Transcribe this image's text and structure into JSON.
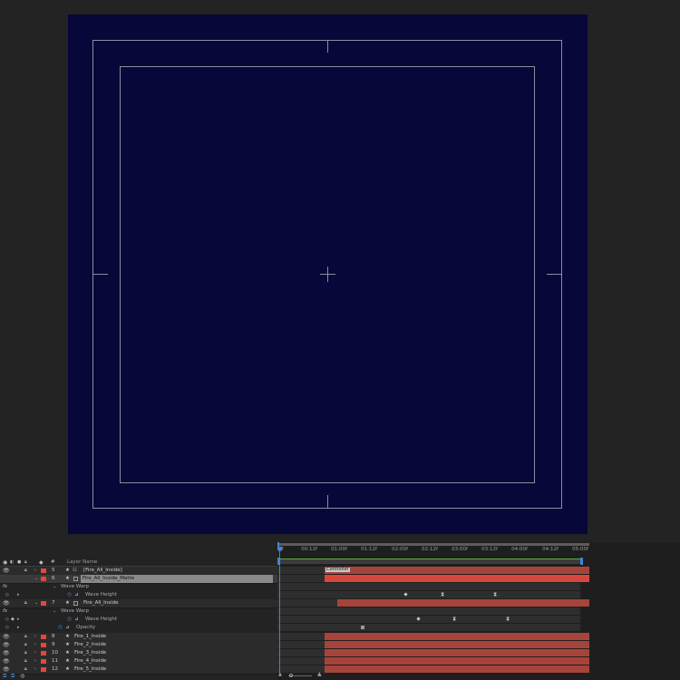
{
  "colors": {
    "comp_background": "#07073a",
    "label_red": "#e0483e",
    "playhead_blue": "#3d87d6",
    "work_area_green": "#5fae3c"
  },
  "layer_header": {
    "hash": "#",
    "layer_name": "Layer Name"
  },
  "layers": [
    {
      "num": "5",
      "name": "[Fire_All_Inside]"
    },
    {
      "num": "6",
      "name": "Fire_All_Inside_Matte"
    },
    {
      "num": "7",
      "name": "Fire_All_Inside"
    },
    {
      "num": "8",
      "name": "Fire_1_Inside"
    },
    {
      "num": "9",
      "name": "Fire_2_Inside"
    },
    {
      "num": "10",
      "name": "Fire_3_Inside"
    },
    {
      "num": "11",
      "name": "Fire_4_Inside"
    },
    {
      "num": "12",
      "name": "Fire_5_Inside"
    }
  ],
  "effects": {
    "fx": "fx",
    "wave_warp": "Wave Warp",
    "wave_height": "Wave Height",
    "opacity": "Opacity"
  },
  "ruler_ticks": [
    "0f",
    "00:12f",
    "01:00f",
    "01:12f",
    "02:00f",
    "02:12f",
    "03:00f",
    "03:12f",
    "04:00f",
    "04:12f",
    "05:00f"
  ],
  "marker_label": "Controller",
  "icons": {
    "visibility": "eye-icon",
    "lock": "lock-icon",
    "label": "tag-icon",
    "stopwatch": "stopwatch-icon",
    "graph": "graph-icon",
    "zoom_out": "mountain-small-icon",
    "zoom_in": "mountain-large-icon"
  }
}
